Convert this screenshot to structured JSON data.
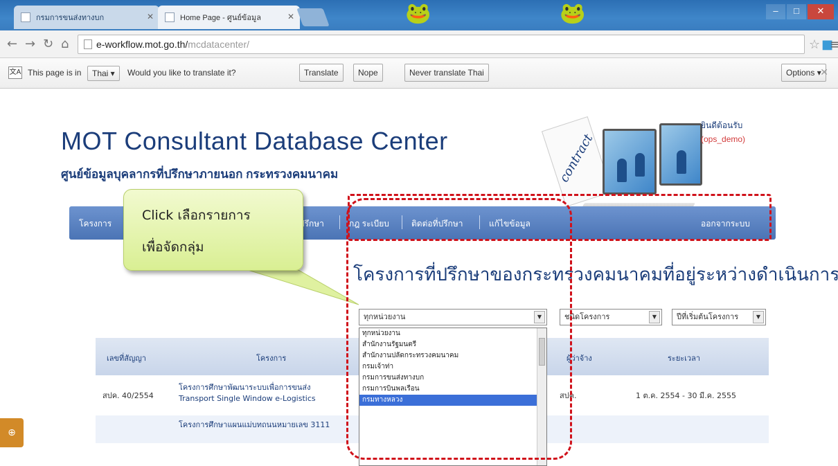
{
  "browser": {
    "tabs": [
      {
        "label": "กรมการขนส่งทางบก"
      },
      {
        "label": "Home Page - ศูนย์ข้อมูล"
      }
    ],
    "address": {
      "host": "e-workflow.mot.go.th/",
      "path": "mcdatacenter/"
    },
    "translate_bar": {
      "prefix": "This page is in",
      "language": "Thai",
      "question": "Would you like to translate it?",
      "translate": "Translate",
      "nope": "Nope",
      "never": "Never translate Thai",
      "options": "Options"
    }
  },
  "site": {
    "title": "MOT Consultant Database Center",
    "subtitle": "ศูนย์ข้อมูลบุคลากรที่ปรึกษาภายนอก กระทรวงคมนาคม",
    "welcome": "ยินดีต้อนรับ",
    "user": "(ops_demo)",
    "contract_word": "contract"
  },
  "nav": {
    "items": [
      "โครงการ",
      "ที่ปรึกษา",
      "กฎ ระเบียบ",
      "ติดต่อที่ปรึกษา",
      "แก้ไขข้อมูล"
    ],
    "logout": "ออกจากระบบ"
  },
  "callout": {
    "line1": "Click เลือกรายการ",
    "line2": "เพื่อจัดกลุ่ม"
  },
  "headline": "โครงการที่ปรึกษาของกระทรวงคมนาคมที่อยู่ระหว่างดำเนินการ",
  "filters": {
    "agency": "ทุกหน่วยงาน",
    "type_label": "ชนิดโครงการ",
    "sort": "ปีที่เริ่มต้นโครงการ"
  },
  "dropdown_options": [
    {
      "label": "ทุกหน่วยงาน"
    },
    {
      "label": "สำนักงานรัฐมนตรี"
    },
    {
      "label": "สำนักงานปลัดกระทรวงคมนาคม"
    },
    {
      "label": "กรมเจ้าท่า"
    },
    {
      "label": "กรมการขนส่งทางบก"
    },
    {
      "label": "กรมการบินพลเรือน"
    },
    {
      "label": "กรมทางหลวง"
    }
  ],
  "table": {
    "headers": [
      "เลขที่สัญญา",
      "โครงการ",
      "ผู้ว่าจ้าง",
      "ระยะเวลา"
    ],
    "rows": [
      {
        "contract": "สปค. 40/2554",
        "project_line1": "โครงการศึกษาพัฒนาระบบเพื่อการขนส่ง",
        "project_line2": "Transport Single Window e-Logistics",
        "employer": "สปค.",
        "period": "1 ต.ค. 2554 - 30 มี.ค. 2555"
      },
      {
        "contract": "",
        "project_line1": "โครงการศึกษาแผนแม่บทถนนหมายเลข 3111",
        "project_line2": "",
        "employer": "",
        "period": ""
      }
    ]
  },
  "colors": {
    "brand": "#1b3d7a",
    "nav": "#4b74b5",
    "highlight": "#d0121b",
    "selected": "#3b6fd8"
  }
}
